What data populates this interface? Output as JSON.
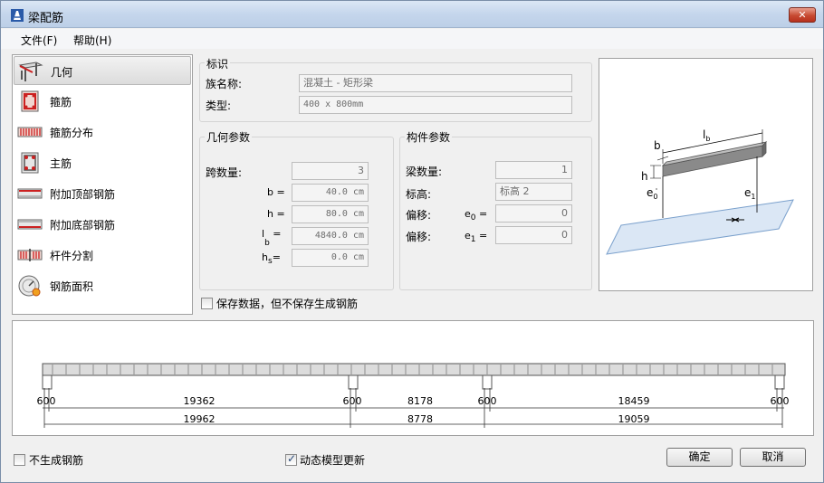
{
  "window": {
    "title": "梁配筋"
  },
  "menu": {
    "file": "文件(F)",
    "help": "帮助(H)"
  },
  "nav": {
    "items": [
      {
        "label": "几何",
        "icon": "beam-geometry-icon"
      },
      {
        "label": "箍筋",
        "icon": "stirrup-icon"
      },
      {
        "label": "箍筋分布",
        "icon": "stirrup-distribution-icon"
      },
      {
        "label": "主筋",
        "icon": "main-bar-icon"
      },
      {
        "label": "附加顶部钢筋",
        "icon": "additional-top-bar-icon"
      },
      {
        "label": "附加底部钢筋",
        "icon": "additional-bottom-bar-icon"
      },
      {
        "label": "杆件分割",
        "icon": "member-split-icon"
      },
      {
        "label": "钢筋面积",
        "icon": "rebar-area-icon"
      }
    ],
    "selected": "几何"
  },
  "identity": {
    "title": "标识",
    "family_label": "族名称:",
    "family_value": "混凝土 - 矩形梁",
    "type_label": "类型:",
    "type_value": "400 x 800mm"
  },
  "geometry": {
    "title": "几何参数",
    "span_label": "跨数量:",
    "span_value": "3",
    "b_label": "b =",
    "b_value": "40.0 cm",
    "h_label": "h =",
    "h_value": "80.0 cm",
    "lb_label": "l",
    "lb_sub": "b",
    "lb_eq": "=",
    "lb_value": "4840.0 cm",
    "hs_label": "h",
    "hs_sub": "s",
    "hs_eq": "=",
    "hs_value": "0.0 cm"
  },
  "member": {
    "title": "构件参数",
    "beam_count_label": "梁数量:",
    "beam_count_value": "1",
    "level_label": "标高:",
    "level_value": "标高 2",
    "offset0_label": "偏移:",
    "e0_label": "e",
    "e0_sub": "0",
    "e0_eq": "=",
    "offset0_value": "0",
    "offset1_label": "偏移:",
    "e1_label": "e",
    "e1_sub": "1",
    "e1_eq": "=",
    "offset1_value": "0"
  },
  "preview": {
    "lb": "l",
    "lb_sub": "b",
    "b": "b",
    "h": "h",
    "e0": "e",
    "e0_sub": "0",
    "e1": "e",
    "e1_sub": "1"
  },
  "save_data_checkbox": {
    "label": "保存数据，但不保存生成钢筋",
    "checked": false
  },
  "beam_diagram": {
    "top_dims": [
      "600",
      "19362",
      "600",
      "8178",
      "600",
      "18459",
      "600"
    ],
    "bottom_dims": [
      "19962",
      "8778",
      "19059"
    ]
  },
  "no_rebar_checkbox": {
    "label": "不生成钢筋",
    "checked": false
  },
  "dynamic_update_checkbox": {
    "label": "动态模型更新",
    "checked": true
  },
  "buttons": {
    "ok": "确定",
    "cancel": "取消"
  }
}
